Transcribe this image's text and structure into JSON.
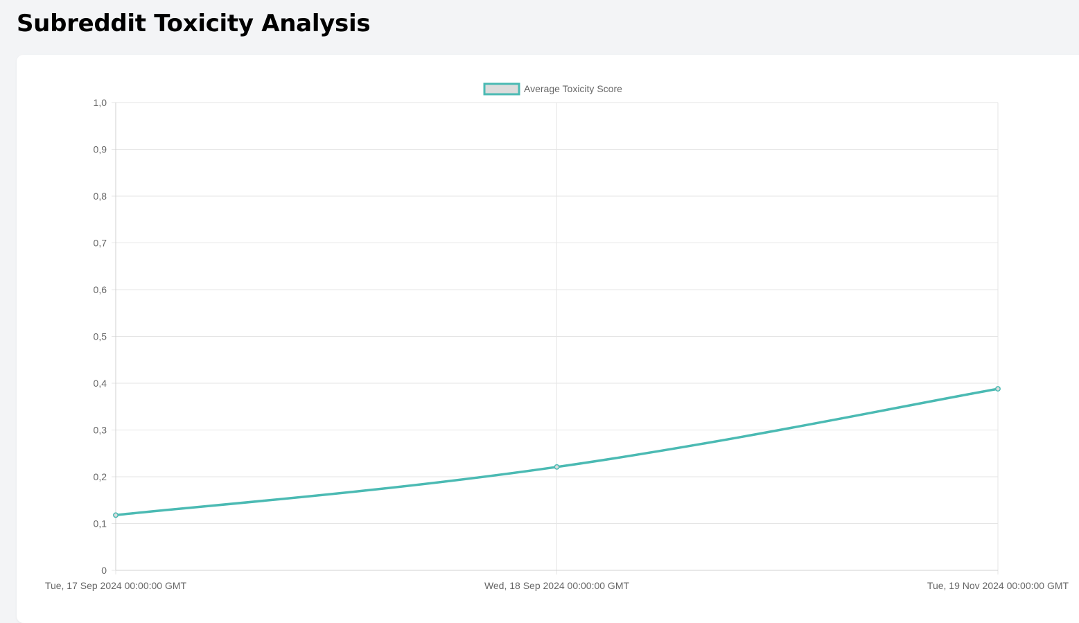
{
  "page": {
    "title": "Subreddit Toxicity Analysis"
  },
  "colors": {
    "series_line": "#4bbab3",
    "series_fill": "#dcdcdc",
    "grid": "#e5e5e5",
    "tick_text": "#666666"
  },
  "chart_data": {
    "type": "line",
    "x": [
      "Tue, 17 Sep 2024 00:00:00 GMT",
      "Wed, 18 Sep 2024 00:00:00 GMT",
      "Tue, 19 Nov 2024 00:00:00 GMT"
    ],
    "series": [
      {
        "name": "Average Toxicity Score",
        "values": [
          0.118,
          0.221,
          0.388
        ]
      }
    ],
    "yticks": [
      "0",
      "0,1",
      "0,2",
      "0,3",
      "0,4",
      "0,5",
      "0,6",
      "0,7",
      "0,8",
      "0,9",
      "1,0"
    ],
    "ylim": [
      0,
      1.0
    ],
    "grid": true,
    "legend": "top-center",
    "title": "",
    "xlabel": "",
    "ylabel": ""
  }
}
